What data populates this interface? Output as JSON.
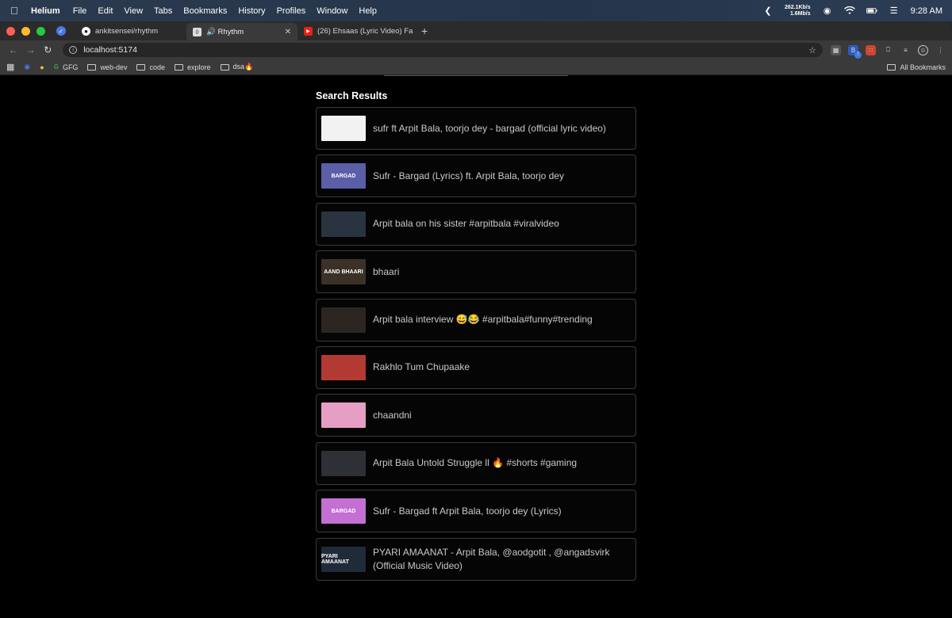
{
  "menubar": {
    "items": [
      "Helium",
      "File",
      "Edit",
      "View",
      "Tabs",
      "Bookmarks",
      "History",
      "Profiles",
      "Window",
      "Help"
    ],
    "net_up": "262.1Kb/s",
    "net_down": "1.6Mb/s",
    "time": "9:28 AM"
  },
  "tabs": [
    {
      "label": "ankitsensei/rhythm",
      "icon": "github-icon"
    },
    {
      "label": "🔊 Rhythm",
      "icon": "rhythm-icon",
      "active": true
    },
    {
      "label": "(26) Ehsaas (Lyric Video) Fa",
      "icon": "youtube-icon"
    }
  ],
  "address": {
    "url": "localhost:5174"
  },
  "bookmarks": {
    "items": [
      "GFG",
      "web-dev",
      "code",
      "explore",
      "dsa🔥"
    ],
    "all_label": "All Bookmarks"
  },
  "extension_badge": "7",
  "results": {
    "heading": "Search Results",
    "items": [
      {
        "title": "sufr ft Arpit Bala, toorjo dey - bargad (official lyric video)",
        "thumb_text": "",
        "thumb_bg": "#f2f2f2"
      },
      {
        "title": "Sufr - Bargad (Lyrics) ft. Arpit Bala, toorjo dey",
        "thumb_text": "BARGAD",
        "thumb_bg": "#5a5fa8"
      },
      {
        "title": "Arpit bala on his sister #arpitbala #viralvideo",
        "thumb_text": "",
        "thumb_bg": "#2a3440"
      },
      {
        "title": "bhaari",
        "thumb_text": "AAND BHAARI",
        "thumb_bg": "#3b3126"
      },
      {
        "title": "Arpit bala interview 😅😂 #arpitbala#funny#trending",
        "thumb_text": "",
        "thumb_bg": "#2c2622"
      },
      {
        "title": "Rakhlo Tum Chupaake",
        "thumb_text": "",
        "thumb_bg": "#b23a32"
      },
      {
        "title": "chaandni",
        "thumb_text": "",
        "thumb_bg": "#e79ec4"
      },
      {
        "title": "Arpit Bala Untold Struggle ll 🔥 #shorts #gaming",
        "thumb_text": "",
        "thumb_bg": "#2d3136"
      },
      {
        "title": "Sufr - Bargad ft Arpit Bala, toorjo dey (Lyrics)",
        "thumb_text": "BARGAD",
        "thumb_bg": "#c36fd3"
      },
      {
        "title": "PYARI AMAANAT - Arpit Bala, @aodgotit , @angadsvirk (Official Music Video)",
        "thumb_text": "PYARI AMAANAT",
        "thumb_bg": "#1f2b38"
      }
    ]
  }
}
